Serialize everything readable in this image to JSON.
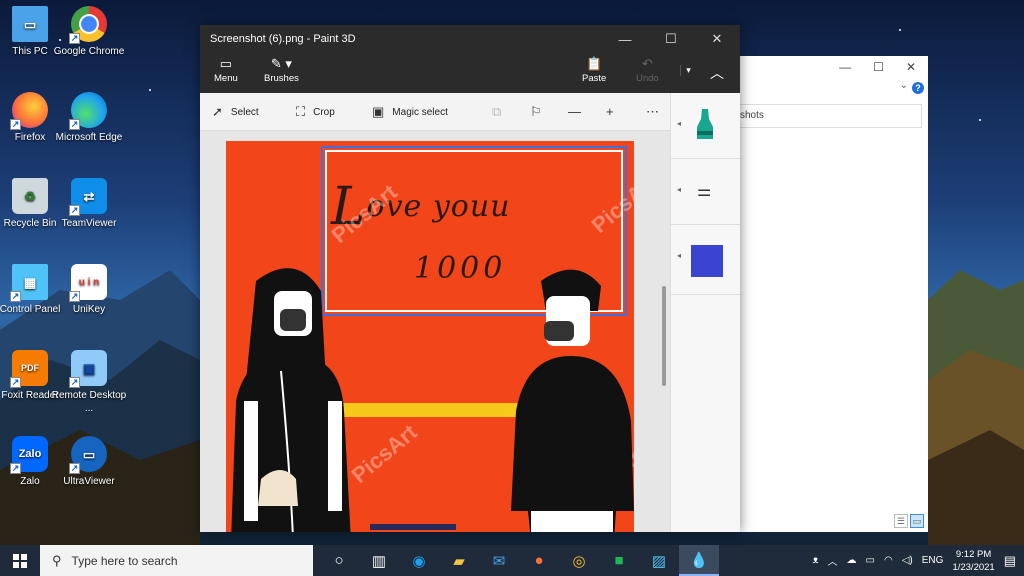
{
  "desktop_icons": [
    {
      "label": "This PC",
      "icon": "this-pc-icon",
      "color": "#4aa3e8"
    },
    {
      "label": "Google Chrome",
      "icon": "chrome-icon",
      "color": "#e53935"
    },
    {
      "label": "Firefox",
      "icon": "firefox-icon",
      "color": "#ff7139"
    },
    {
      "label": "Microsoft Edge",
      "icon": "edge-icon",
      "color": "#1da1f2"
    },
    {
      "label": "Recycle Bin",
      "icon": "recycle-bin-icon",
      "color": "#cfd8dc"
    },
    {
      "label": "TeamViewer",
      "icon": "teamviewer-icon",
      "color": "#0e8ee9"
    },
    {
      "label": "Control Panel",
      "icon": "control-panel-icon",
      "color": "#4fc3f7"
    },
    {
      "label": "UniKey",
      "icon": "unikey-icon",
      "color": "#e53935"
    },
    {
      "label": "Foxit Reader",
      "icon": "foxit-reader-icon",
      "color": "#f57c00"
    },
    {
      "label": "Remote Desktop ...",
      "icon": "remote-desktop-icon",
      "color": "#90caf9"
    },
    {
      "label": "Zalo",
      "icon": "zalo-icon",
      "color": "#0068ff"
    },
    {
      "label": "UltraViewer",
      "icon": "ultraviewer-icon",
      "color": "#1565c0"
    }
  ],
  "paint": {
    "title": "Screenshot (6).png - Paint 3D",
    "menu_label": "Menu",
    "brushes_label": "Brushes",
    "paste_label": "Paste",
    "undo_label": "Undo",
    "tools": {
      "select": "Select",
      "crop": "Crop",
      "magic_select": "Magic select"
    },
    "swatch_color": "#3a44d0"
  },
  "image": {
    "line1_cap": "L",
    "line1": "ove youu",
    "line2": "1000",
    "watermark": "PicsArt"
  },
  "explorer": {
    "address_fragment": "shots"
  },
  "taskbar": {
    "search_placeholder": "Type here to search",
    "language": "ENG",
    "time": "9:12 PM",
    "date": "1/23/2021"
  }
}
